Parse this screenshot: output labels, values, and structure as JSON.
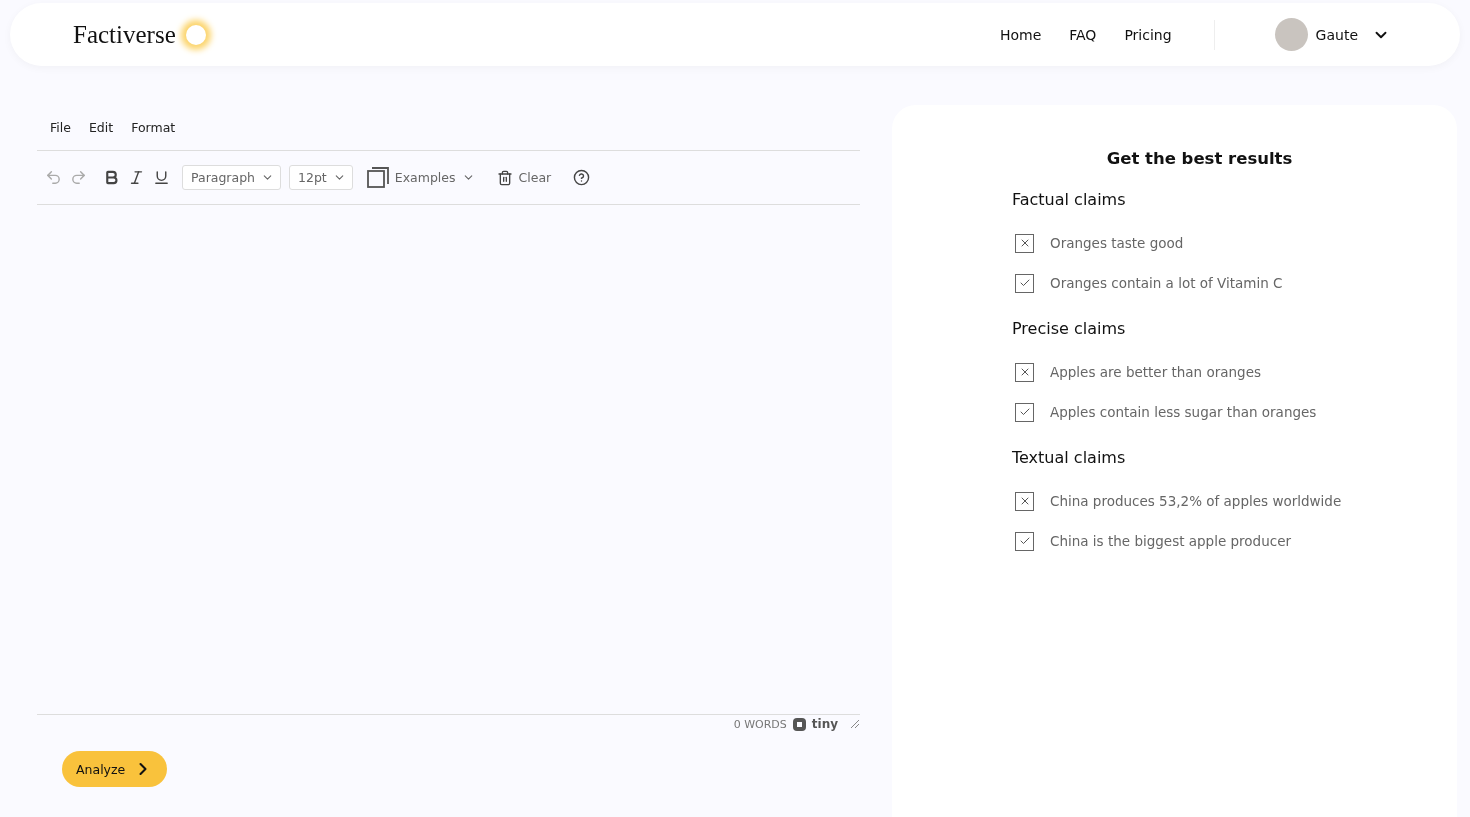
{
  "header": {
    "logo": "Factiverse",
    "nav": [
      "Home",
      "FAQ",
      "Pricing"
    ],
    "user": {
      "name": "Gaute"
    }
  },
  "editor": {
    "menu": [
      "File",
      "Edit",
      "Format"
    ],
    "toolbar": {
      "block_format": "Paragraph",
      "font_size": "12pt",
      "examples": "Examples",
      "clear": "Clear"
    },
    "status": {
      "word_count": "0 WORDS",
      "brand": "tiny"
    }
  },
  "analyze_button": "Analyze",
  "tips": {
    "title": "Get the best results",
    "sections": [
      {
        "heading": "Factual claims",
        "examples": [
          {
            "kind": "bad",
            "text": "Oranges taste good"
          },
          {
            "kind": "good",
            "text": "Oranges contain a lot of Vitamin C"
          }
        ]
      },
      {
        "heading": "Precise claims",
        "examples": [
          {
            "kind": "bad",
            "text": "Apples are better than oranges"
          },
          {
            "kind": "good",
            "text": "Apples contain less sugar than oranges"
          }
        ]
      },
      {
        "heading": "Textual claims",
        "examples": [
          {
            "kind": "bad",
            "text": "China produces 53,2% of apples worldwide"
          },
          {
            "kind": "good",
            "text": "China is the biggest apple producer"
          }
        ]
      }
    ]
  }
}
